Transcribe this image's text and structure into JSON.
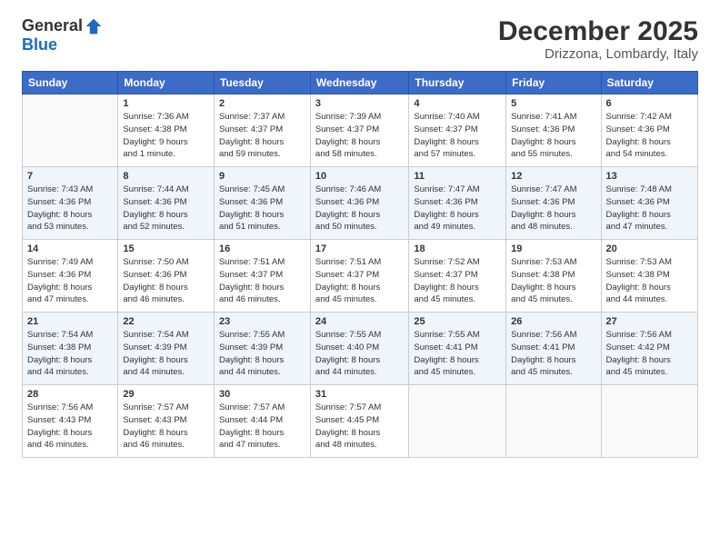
{
  "logo": {
    "general": "General",
    "blue": "Blue"
  },
  "title": "December 2025",
  "location": "Drizzona, Lombardy, Italy",
  "days_header": [
    "Sunday",
    "Monday",
    "Tuesday",
    "Wednesday",
    "Thursday",
    "Friday",
    "Saturday"
  ],
  "weeks": [
    [
      {
        "day": "",
        "info": ""
      },
      {
        "day": "1",
        "info": "Sunrise: 7:36 AM\nSunset: 4:38 PM\nDaylight: 9 hours\nand 1 minute."
      },
      {
        "day": "2",
        "info": "Sunrise: 7:37 AM\nSunset: 4:37 PM\nDaylight: 8 hours\nand 59 minutes."
      },
      {
        "day": "3",
        "info": "Sunrise: 7:39 AM\nSunset: 4:37 PM\nDaylight: 8 hours\nand 58 minutes."
      },
      {
        "day": "4",
        "info": "Sunrise: 7:40 AM\nSunset: 4:37 PM\nDaylight: 8 hours\nand 57 minutes."
      },
      {
        "day": "5",
        "info": "Sunrise: 7:41 AM\nSunset: 4:36 PM\nDaylight: 8 hours\nand 55 minutes."
      },
      {
        "day": "6",
        "info": "Sunrise: 7:42 AM\nSunset: 4:36 PM\nDaylight: 8 hours\nand 54 minutes."
      }
    ],
    [
      {
        "day": "7",
        "info": "Sunrise: 7:43 AM\nSunset: 4:36 PM\nDaylight: 8 hours\nand 53 minutes."
      },
      {
        "day": "8",
        "info": "Sunrise: 7:44 AM\nSunset: 4:36 PM\nDaylight: 8 hours\nand 52 minutes."
      },
      {
        "day": "9",
        "info": "Sunrise: 7:45 AM\nSunset: 4:36 PM\nDaylight: 8 hours\nand 51 minutes."
      },
      {
        "day": "10",
        "info": "Sunrise: 7:46 AM\nSunset: 4:36 PM\nDaylight: 8 hours\nand 50 minutes."
      },
      {
        "day": "11",
        "info": "Sunrise: 7:47 AM\nSunset: 4:36 PM\nDaylight: 8 hours\nand 49 minutes."
      },
      {
        "day": "12",
        "info": "Sunrise: 7:47 AM\nSunset: 4:36 PM\nDaylight: 8 hours\nand 48 minutes."
      },
      {
        "day": "13",
        "info": "Sunrise: 7:48 AM\nSunset: 4:36 PM\nDaylight: 8 hours\nand 47 minutes."
      }
    ],
    [
      {
        "day": "14",
        "info": "Sunrise: 7:49 AM\nSunset: 4:36 PM\nDaylight: 8 hours\nand 47 minutes."
      },
      {
        "day": "15",
        "info": "Sunrise: 7:50 AM\nSunset: 4:36 PM\nDaylight: 8 hours\nand 46 minutes."
      },
      {
        "day": "16",
        "info": "Sunrise: 7:51 AM\nSunset: 4:37 PM\nDaylight: 8 hours\nand 46 minutes."
      },
      {
        "day": "17",
        "info": "Sunrise: 7:51 AM\nSunset: 4:37 PM\nDaylight: 8 hours\nand 45 minutes."
      },
      {
        "day": "18",
        "info": "Sunrise: 7:52 AM\nSunset: 4:37 PM\nDaylight: 8 hours\nand 45 minutes."
      },
      {
        "day": "19",
        "info": "Sunrise: 7:53 AM\nSunset: 4:38 PM\nDaylight: 8 hours\nand 45 minutes."
      },
      {
        "day": "20",
        "info": "Sunrise: 7:53 AM\nSunset: 4:38 PM\nDaylight: 8 hours\nand 44 minutes."
      }
    ],
    [
      {
        "day": "21",
        "info": "Sunrise: 7:54 AM\nSunset: 4:38 PM\nDaylight: 8 hours\nand 44 minutes."
      },
      {
        "day": "22",
        "info": "Sunrise: 7:54 AM\nSunset: 4:39 PM\nDaylight: 8 hours\nand 44 minutes."
      },
      {
        "day": "23",
        "info": "Sunrise: 7:55 AM\nSunset: 4:39 PM\nDaylight: 8 hours\nand 44 minutes."
      },
      {
        "day": "24",
        "info": "Sunrise: 7:55 AM\nSunset: 4:40 PM\nDaylight: 8 hours\nand 44 minutes."
      },
      {
        "day": "25",
        "info": "Sunrise: 7:55 AM\nSunset: 4:41 PM\nDaylight: 8 hours\nand 45 minutes."
      },
      {
        "day": "26",
        "info": "Sunrise: 7:56 AM\nSunset: 4:41 PM\nDaylight: 8 hours\nand 45 minutes."
      },
      {
        "day": "27",
        "info": "Sunrise: 7:56 AM\nSunset: 4:42 PM\nDaylight: 8 hours\nand 45 minutes."
      }
    ],
    [
      {
        "day": "28",
        "info": "Sunrise: 7:56 AM\nSunset: 4:43 PM\nDaylight: 8 hours\nand 46 minutes."
      },
      {
        "day": "29",
        "info": "Sunrise: 7:57 AM\nSunset: 4:43 PM\nDaylight: 8 hours\nand 46 minutes."
      },
      {
        "day": "30",
        "info": "Sunrise: 7:57 AM\nSunset: 4:44 PM\nDaylight: 8 hours\nand 47 minutes."
      },
      {
        "day": "31",
        "info": "Sunrise: 7:57 AM\nSunset: 4:45 PM\nDaylight: 8 hours\nand 48 minutes."
      },
      {
        "day": "",
        "info": ""
      },
      {
        "day": "",
        "info": ""
      },
      {
        "day": "",
        "info": ""
      }
    ]
  ]
}
